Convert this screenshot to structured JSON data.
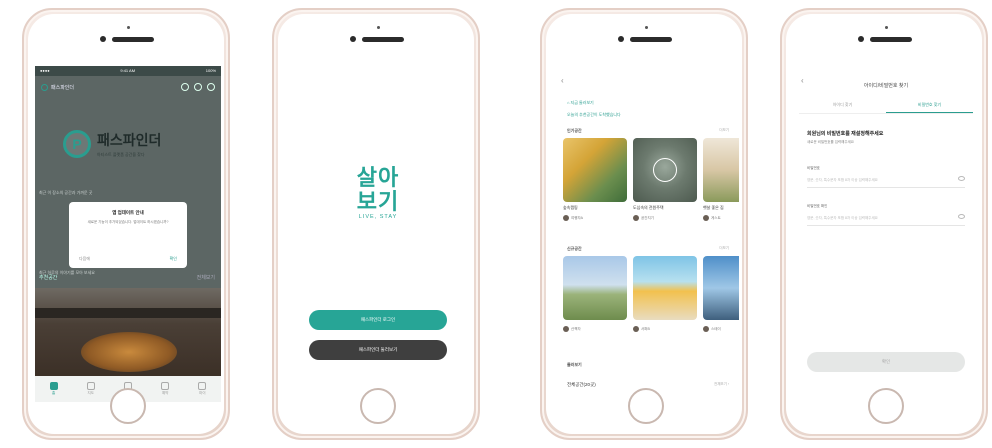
{
  "screen1": {
    "status": {
      "left": "●●●● ",
      "center": "9:41 AM",
      "right": "100%"
    },
    "app_name": "패스파인더",
    "logo_title": "패스파인더",
    "logo_sub": "아티스트 플랫폼 공간을 찾다",
    "bg_line1": "최근 이 장소의 공간과 가까운 곳",
    "bg_line2": "최근 하루의 이야기를 모아 보세요",
    "modal_title": "앱 업데이트 안내",
    "modal_body": "새로운 기능이 추가되었습니다. 업데이트 하시겠습니까?",
    "modal_cancel": "다음에",
    "modal_ok": "확인",
    "section_label": "추천공간",
    "section_more": "전체보기",
    "tabs": [
      "홈",
      "지도",
      "공간",
      "예약",
      "마이"
    ]
  },
  "screen2": {
    "brand_korean": "살아\n보기",
    "brand_english": "LIVE, STAY",
    "primary_button": "패스파인더 로그인",
    "secondary_button": "패스파인더 둘러보기"
  },
  "screen3": {
    "back": "‹",
    "chip": "⌂ 지금 둘러보기",
    "headline": "오늘의 추천공간이 도착했습니다",
    "section1": "인기공간",
    "section2": "신규공간",
    "section3": "둘러보기",
    "more": "더보기",
    "cards_row1": [
      {
        "caption": "숲속캠핑",
        "author": "여행자A"
      },
      {
        "caption": "도심속의 전원주택",
        "author": "공간지기"
      },
      {
        "caption": "햇살 좋은 집",
        "author": "게스트"
      }
    ],
    "cards_row2": [
      {
        "caption": "들판 위의 쉼터",
        "author": "산책자"
      },
      {
        "caption": "바닷가 하우스",
        "author": "서퍼B"
      },
      {
        "caption": "하늘 정원",
        "author": "스테이"
      }
    ],
    "footer_left": "전체공간(20곳)",
    "footer_right": "전체보기 ›"
  },
  "screen4": {
    "back": "‹",
    "title": "아이디/비밀번호 찾기",
    "tab1": "아이디 찾기",
    "tab2": "비밀번호 찾기",
    "heading": "회원님의 비밀번호를 재설정해주세요",
    "subheading": "새로운 비밀번호를 입력해주세요",
    "label1": "비밀번호",
    "placeholder1": "영문, 숫자, 특수문자 포함 8자 이상 입력해주세요",
    "label2": "비밀번호 확인",
    "placeholder2": "영문, 숫자, 특수문자 포함 8자 이상 입력해주세요",
    "confirm_button": "확인"
  }
}
